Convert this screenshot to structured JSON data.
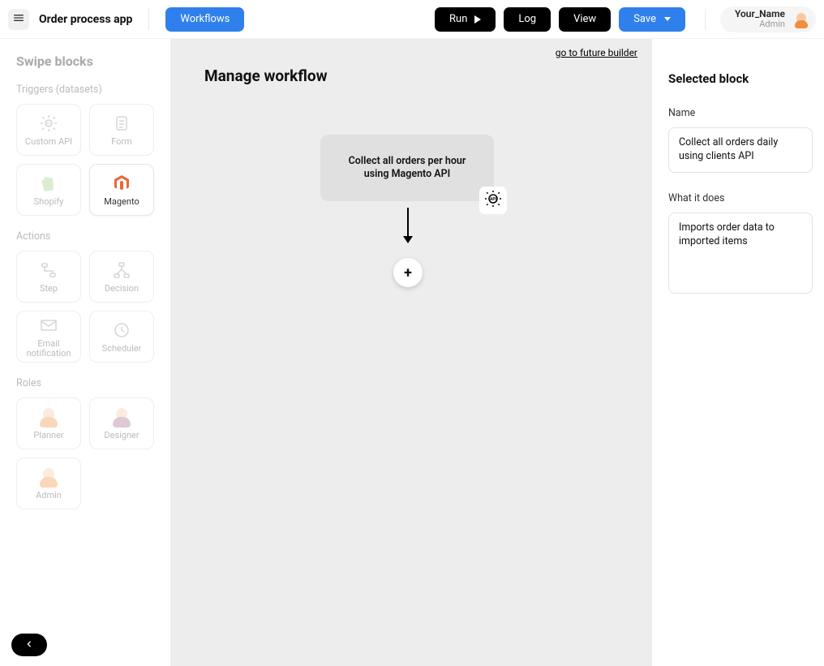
{
  "header": {
    "app_title": "Order process app",
    "workflows_btn": "Workflows",
    "run_btn": "Run",
    "log_btn": "Log",
    "view_btn": "View",
    "save_btn": "Save",
    "user_name": "Your_Name",
    "user_role": "Admin"
  },
  "sidebar": {
    "title": "Swipe blocks",
    "sections": {
      "triggers": {
        "label": "Triggers (datasets)",
        "items": [
          {
            "label": "Custom API",
            "icon": "api-gear"
          },
          {
            "label": "Form",
            "icon": "form"
          },
          {
            "label": "Shopify",
            "icon": "shopify"
          },
          {
            "label": "Magento",
            "icon": "magento",
            "active": true
          }
        ]
      },
      "actions": {
        "label": "Actions",
        "items": [
          {
            "label": "Step",
            "icon": "step"
          },
          {
            "label": "Decision",
            "icon": "decision"
          },
          {
            "label": "Email notification",
            "icon": "email"
          },
          {
            "label": "Scheduler",
            "icon": "clock"
          }
        ]
      },
      "roles": {
        "label": "Roles",
        "items": [
          {
            "label": "Planner",
            "icon": "person-planner"
          },
          {
            "label": "Designer",
            "icon": "person-designer"
          },
          {
            "label": "Admin",
            "icon": "person-admin"
          }
        ]
      }
    }
  },
  "canvas": {
    "title": "Manage workflow",
    "future_link": "go to future builder",
    "node": {
      "line1": "Collect all orders per hour",
      "line2": "using Magento API"
    },
    "add_label": "+"
  },
  "rightpanel": {
    "title": "Selected block",
    "name_label": "Name",
    "name_value": "Collect all orders daily using clients API",
    "desc_label": "What it does",
    "desc_value": "Imports order data to imported items"
  }
}
